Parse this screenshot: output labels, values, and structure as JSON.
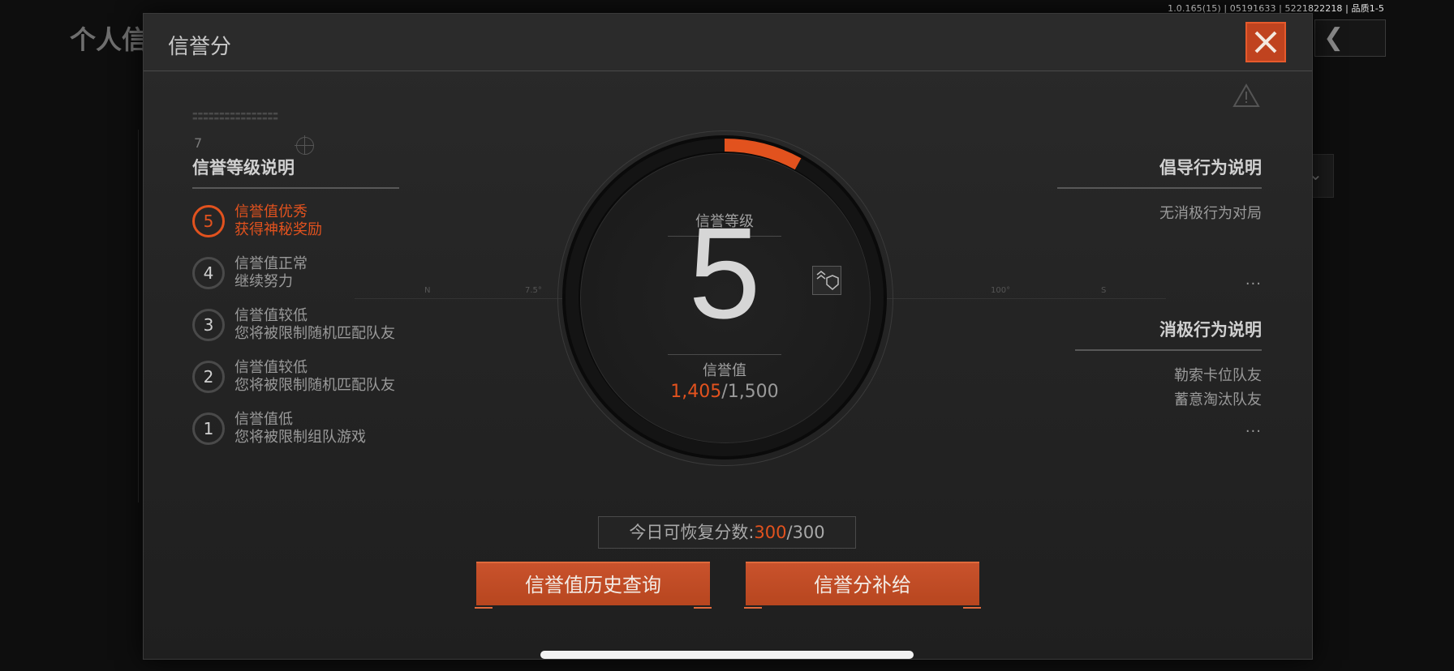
{
  "status_bar": {
    "version_text": "1.0.165(15) | 05191633 | 5221822218 | 品质1-5"
  },
  "background_page": {
    "title": "个人信"
  },
  "modal": {
    "title": "信誉分",
    "deco_number": "7"
  },
  "levels": {
    "title": "信誉等级说明",
    "items": [
      {
        "level": "5",
        "line1": "信誉值优秀",
        "line2": "获得神秘奖励",
        "active": true
      },
      {
        "level": "4",
        "line1": "信誉值正常",
        "line2": "继续努力",
        "active": false
      },
      {
        "level": "3",
        "line1": "信誉值较低",
        "line2": "您将被限制随机匹配队友",
        "active": false
      },
      {
        "level": "2",
        "line1": "信誉值较低",
        "line2": "您将被限制随机匹配队友",
        "active": false
      },
      {
        "level": "1",
        "line1": "信誉值低",
        "line2": "您将被限制组队游戏",
        "active": false
      }
    ]
  },
  "gauge": {
    "level_label": "信誉等级",
    "level_value": "5",
    "score_label": "信誉值",
    "score_current": "1,405",
    "score_max": "/1,500",
    "progress_fraction": 0.08
  },
  "compass_ticks": [
    "N",
    "7.5°",
    "100°",
    "S"
  ],
  "positive": {
    "title": "倡导行为说明",
    "items": [
      "无消极行为对局"
    ],
    "more": "..."
  },
  "negative": {
    "title": "消极行为说明",
    "items": [
      "勒索卡位队友",
      "蓄意淘汰队友"
    ],
    "more": "..."
  },
  "recover": {
    "label": "今日可恢复分数:",
    "current": "300",
    "max": "/300"
  },
  "buttons": {
    "history": "信誉值历史查询",
    "supply": "信誉分补给"
  },
  "colors": {
    "accent": "#e2521e",
    "button": "#c0491f"
  }
}
